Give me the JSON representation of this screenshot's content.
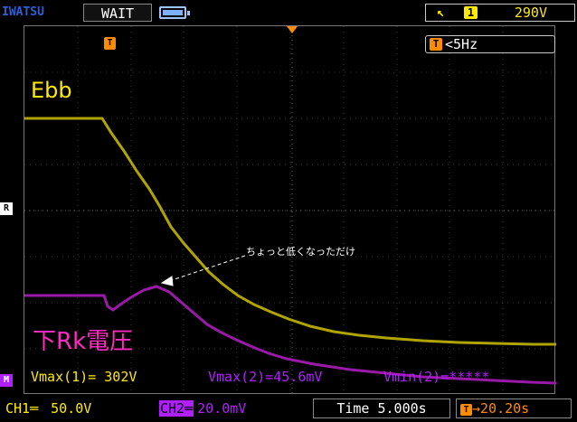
{
  "header": {
    "brand": "IWATSU",
    "status": "WAIT",
    "trigger_slope_glyph": "↖",
    "trigger_channel": "1",
    "trigger_level": "290V"
  },
  "screen": {
    "trigger_marker": "T",
    "freq_label": "<5Hz",
    "ch1_label": "Ebb",
    "ch2_label": "下Rk電圧",
    "annotation": "ちょっと低くなっただけ",
    "ref_marker": "R",
    "ch2_marker": "M"
  },
  "measurements": {
    "vmax1": "Vmax(1)= 302V",
    "vmax2": "Vmax(2)=45.6mV",
    "vmin2": "Vmin(2)=*****"
  },
  "footer": {
    "ch1_tag": "CH1═",
    "ch1_value": "50.0V",
    "ch2_tag": "CH2═",
    "ch2_value": "20.0mV",
    "timebase": "Time 5.000s",
    "trig_pos_tag": "T",
    "trig_pos": "→20.20s"
  },
  "colors": {
    "ch1": "#ffea00",
    "ch1_trace": "#b0a400",
    "ch2": "#b020ff",
    "ch2_trace": "#9a1aa8",
    "label_magenta": "#ff2ac0",
    "trigger_orange": "#ff8c00"
  },
  "icons": {
    "battery": "battery-icon",
    "trigger": "trigger-marker-icon"
  }
}
